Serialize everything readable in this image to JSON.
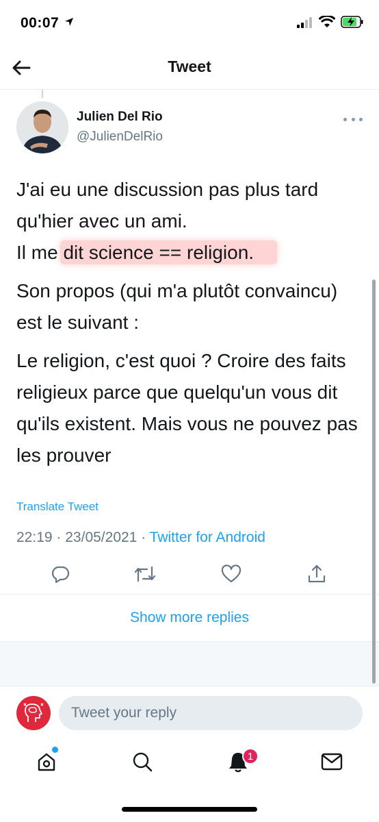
{
  "status_bar": {
    "time": "00:07"
  },
  "header": {
    "title": "Tweet",
    "back_icon": "arrow-left-icon"
  },
  "tweet": {
    "author_name": "Julien Del Rio",
    "author_handle": "@JulienDelRio",
    "line1": "J'ai eu une discussion pas plus tard qu'hier avec un ami.",
    "line2_prefix": "Il me ",
    "line2_highlight": "dit science == religion.",
    "paragraph2": "Son propos (qui m'a plutôt convaincu) est le suivant :",
    "paragraph3": "Le religion, c'est quoi ? Croire des faits religieux parce que quelqu'un vous dit qu'ils existent. Mais vous ne pouvez pas les prouver",
    "translate_label": "Translate Tweet",
    "time": "22:19",
    "date": "23/05/2021",
    "separator": "·",
    "source": "Twitter for Android"
  },
  "actions": {
    "reply_icon": "reply-icon",
    "retweet_icon": "retweet-icon",
    "like_icon": "heart-icon",
    "share_icon": "share-icon"
  },
  "show_more_replies": "Show more replies",
  "reply_bar": {
    "placeholder": "Tweet your reply"
  },
  "tabbar": {
    "notification_count": "1"
  },
  "colors": {
    "accent": "#1da1f2",
    "text": "#14171a",
    "secondary": "#657786",
    "highlight": "#ff7878",
    "badge": "#e0245e"
  }
}
